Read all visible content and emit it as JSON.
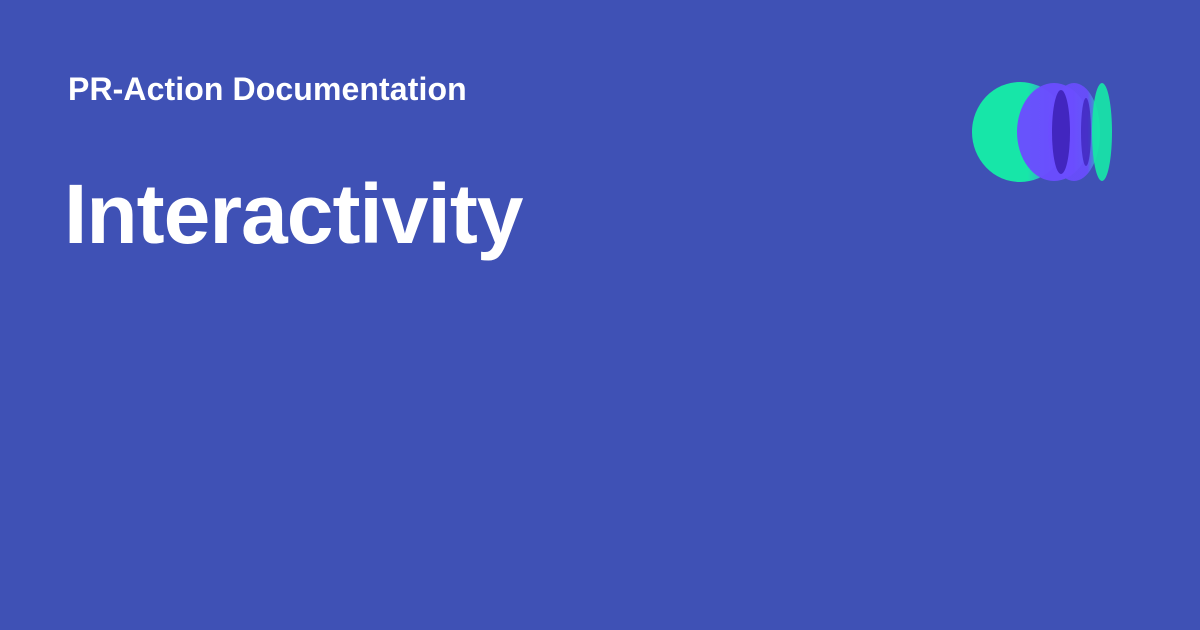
{
  "page": {
    "subtitle": "PR-Action Documentation",
    "title": "Interactivity"
  },
  "theme": {
    "background": "#3f51b5",
    "text": "#ffffff",
    "logo_green": "#17e6a8",
    "logo_purple": "#6b4dff",
    "logo_dark": "#3b1fb4"
  },
  "logo": {
    "icon": "overlapping-circles-logo-icon"
  }
}
